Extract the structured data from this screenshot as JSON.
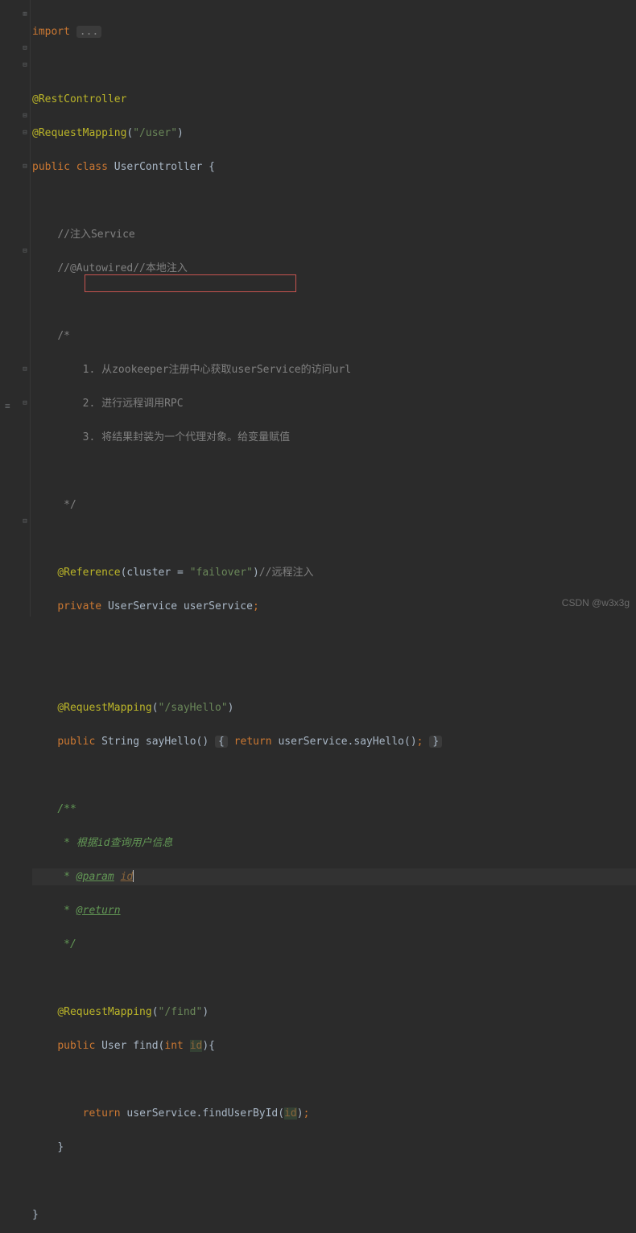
{
  "gutter": {
    "fold_expand": "⊞",
    "fold_collapse": "⊟",
    "sep": "≡"
  },
  "code": {
    "l1_kw": "import",
    "l1_fold": "...",
    "l3_ann": "@RestController",
    "l4_ann": "@RequestMapping",
    "l4_paren_o": "(",
    "l4_str": "\"/user\"",
    "l4_paren_c": ")",
    "l5_pub": "public",
    "l5_cls": "class",
    "l5_name": "UserController {",
    "l7_c": "//注入Service",
    "l8_c": "//@Autowired//本地注入",
    "l10_c": "/*",
    "l11_c": "    1. 从zookeeper注册中心获取userService的访问url",
    "l12_c": "    2. 进行远程调用RPC",
    "l13_c": "    3. 将结果封装为一个代理对象。给变量赋值",
    "l15_c": " */",
    "l17_ann": "@Reference",
    "l17_paren": "(cluster = ",
    "l17_str": "\"failover\"",
    "l17_cparen": ")",
    "l17_cmt": "//远程注入",
    "l18_priv": "private",
    "l18_type": "UserService",
    "l18_field": "userService",
    "l18_semi": ";",
    "l21_ann": "@RequestMapping",
    "l21_po": "(",
    "l21_str": "\"/sayHello\"",
    "l21_pc": ")",
    "l22_pub": "public",
    "l22_type": "String",
    "l22_name": "sayHello()",
    "l22_ob": "{",
    "l22_ret": "return",
    "l22_expr": "userService.sayHello()",
    "l22_semi": ";",
    "l22_cb": "}",
    "l24_d": "/**",
    "l25_d": " * 根据id查询用户信息",
    "l26_star": " * ",
    "l26_tag": "@param",
    "l26_p": "id",
    "l27_star": " * ",
    "l27_tag": "@return",
    "l28_d": " */",
    "l30_ann": "@RequestMapping",
    "l30_po": "(",
    "l30_str": "\"/find\"",
    "l30_pc": ")",
    "l31_pub": "public",
    "l31_type": "User",
    "l31_name": "find(",
    "l31_int": "int",
    "l31_p": "id",
    "l31_close": "){",
    "l33_ret": "return",
    "l33_call1": "userService.findUserById(",
    "l33_arg": "id",
    "l33_call2": ")",
    "l33_semi": ";",
    "l34_cb": "}",
    "l36_cb": "}"
  },
  "watermark": "CSDN @w3x3g"
}
